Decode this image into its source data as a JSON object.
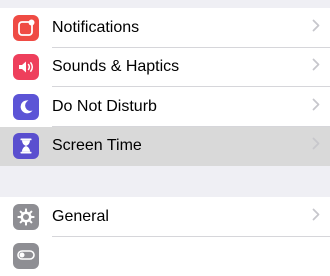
{
  "colors": {
    "notifications": "#ef4b44",
    "sounds": "#ee3f5c",
    "do_not_disturb": "#5c54d6",
    "screen_time": "#5a4fcf",
    "general": "#8e8e93",
    "display": "#8e8e93",
    "highlight": "#d9d9d9",
    "background": "#efeff4"
  },
  "group1": {
    "items": [
      {
        "label": "Notifications",
        "icon": "notifications-icon"
      },
      {
        "label": "Sounds & Haptics",
        "icon": "speaker-icon"
      },
      {
        "label": "Do Not Disturb",
        "icon": "moon-icon"
      },
      {
        "label": "Screen Time",
        "icon": "hourglass-icon",
        "selected": true
      }
    ]
  },
  "group2": {
    "items": [
      {
        "label": "General",
        "icon": "gear-icon"
      },
      {
        "label": "",
        "icon": "toggle-icon"
      }
    ]
  }
}
